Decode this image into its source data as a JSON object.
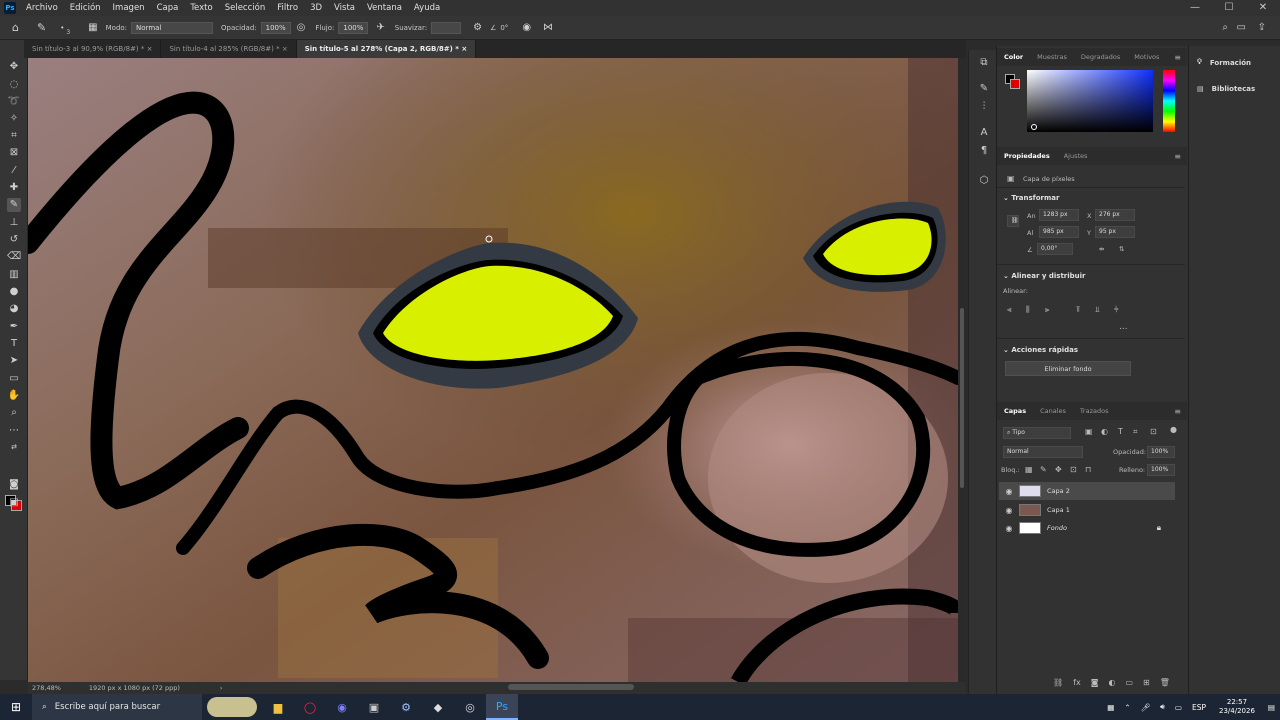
{
  "app": {
    "logo": "Ps"
  },
  "menu": [
    "Archivo",
    "Edición",
    "Imagen",
    "Capa",
    "Texto",
    "Selección",
    "Filtro",
    "3D",
    "Vista",
    "Ventana",
    "Ayuda"
  ],
  "window_controls": {
    "minimize": "—",
    "maximize": "☐",
    "close": "✕"
  },
  "options": {
    "brush_size": "3",
    "mode_label": "Modo:",
    "mode_value": "Normal",
    "opacity_label": "Opacidad:",
    "opacity_value": "100%",
    "flow_label": "Flujo:",
    "flow_value": "100%",
    "smooth_label": "Suavizar:",
    "angle_label": "∠",
    "angle_value": "0°"
  },
  "doc_tabs": [
    {
      "label": "Sin título-3 al 90,9% (RGB/8#) *",
      "active": false
    },
    {
      "label": "Sin título-4 al 285% (RGB/8#) *",
      "active": false
    },
    {
      "label": "Sin título-5 al 278% (Capa 2, RGB/8#) *",
      "active": true
    }
  ],
  "status": {
    "zoom": "278,48%",
    "doc_size": "1920 px x 1080 px (72 ppp)"
  },
  "color_panel": {
    "tabs": [
      "Color",
      "Muestras",
      "Degradados",
      "Motivos"
    ],
    "fg": "#000000",
    "bg": "#e00000"
  },
  "properties": {
    "tabs": [
      "Propiedades",
      "Ajustes"
    ],
    "layer_type": "Capa de píxeles",
    "transform_title": "Transformar",
    "w_label": "An",
    "w_value": "1283 px",
    "x_label": "X",
    "x_value": "276 px",
    "h_label": "Al",
    "h_value": "985 px",
    "y_label": "Y",
    "y_value": "95 px",
    "angle_value": "0,00°",
    "align_title": "Alinear y distribuir",
    "align_label": "Alinear:",
    "more": "...",
    "quick_title": "Acciones rápidas",
    "remove_bg": "Eliminar fondo"
  },
  "layers_panel": {
    "tabs": [
      "Capas",
      "Canales",
      "Trazados"
    ],
    "filter": "Tipo",
    "blend_mode": "Normal",
    "opacity_label": "Opacidad:",
    "opacity_value": "100%",
    "lock_label": "Bloq.:",
    "fill_label": "Relleno:",
    "fill_value": "100%",
    "layers": [
      {
        "name": "Capa 2",
        "selected": true
      },
      {
        "name": "Capa 1",
        "selected": false
      },
      {
        "name": "Fondo",
        "selected": false
      }
    ]
  },
  "right_dock": {
    "items": [
      "Formación",
      "Bibliotecas"
    ]
  },
  "taskbar": {
    "search_placeholder": "Escribe aquí para buscar",
    "lang": "ESP",
    "time": "22:57",
    "date": "23/4/2026"
  }
}
